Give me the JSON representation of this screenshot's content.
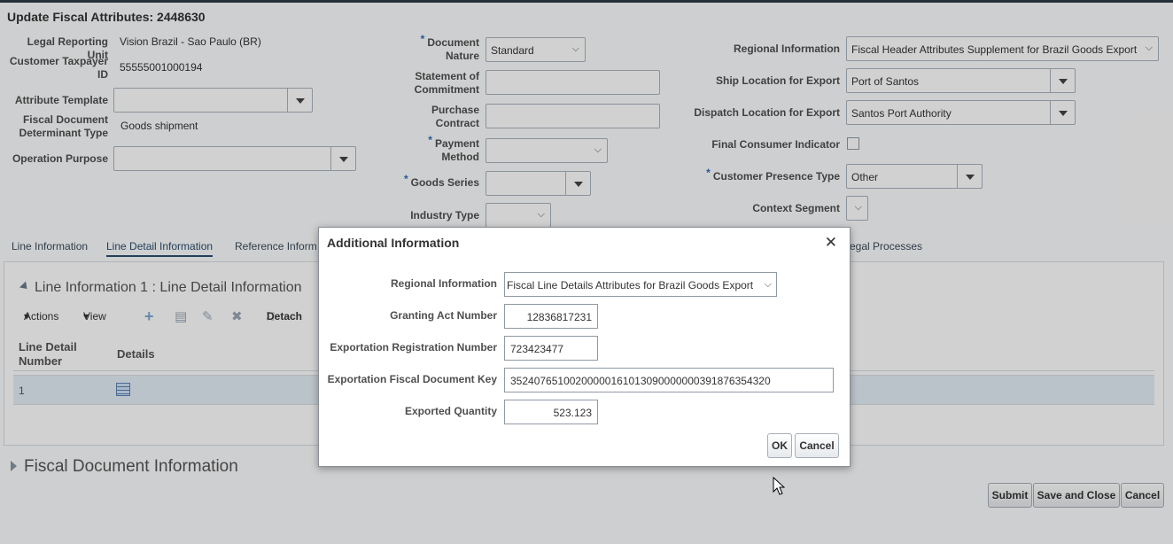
{
  "page": {
    "title": "Update Fiscal Attributes: 2448630"
  },
  "col1": {
    "legal_reporting_unit_label": "Legal Reporting Unit",
    "legal_reporting_unit_value": "Vision Brazil - Sao Paulo (BR)",
    "customer_taxpayer_label1": "Customer Taxpayer",
    "customer_taxpayer_label2": "ID",
    "customer_taxpayer_value": "55555001000194",
    "attribute_template_label": "Attribute Template",
    "attribute_template_value": "",
    "fiscal_doc_label1": "Fiscal Document",
    "fiscal_doc_label2": "Determinant Type",
    "fiscal_doc_value": "Goods shipment",
    "operation_purpose_label": "Operation Purpose",
    "operation_purpose_value": ""
  },
  "col2": {
    "document_nature_label1": "Document",
    "document_nature_label2": "Nature",
    "document_nature_value": "Standard",
    "statement_label1": "Statement of",
    "statement_label2": "Commitment",
    "purchase_label1": "Purchase",
    "purchase_label2": "Contract",
    "payment_label1": "Payment",
    "payment_label2": "Method",
    "goods_series_label": "Goods Series",
    "industry_type_label": "Industry Type",
    "required_mark": "*"
  },
  "col3": {
    "regional_info_label": "Regional Information",
    "regional_info_value": "Fiscal Header Attributes Supplement for Brazil Goods Export",
    "ship_location_label": "Ship Location for Export",
    "ship_location_value": "Port of Santos",
    "dispatch_location_label": "Dispatch Location for Export",
    "dispatch_location_value": "Santos Port Authority",
    "final_consumer_label": "Final Consumer Indicator",
    "customer_presence_label": "Customer Presence Type",
    "customer_presence_value": "Other",
    "context_segment_label": "Context Segment"
  },
  "tabs": [
    {
      "label": "Line Information"
    },
    {
      "label": "Line Detail Information"
    },
    {
      "label": "Reference Inform"
    },
    {
      "label": "egal Processes"
    }
  ],
  "panel": {
    "heading": "Line Information 1 : Line Detail Information",
    "actions_label": "Actions",
    "view_label": "View",
    "detach_label": "Detach",
    "col_line_detail_1": "Line Detail",
    "col_line_detail_2": "Number",
    "col_details": "Details",
    "rows": [
      {
        "number": "1"
      }
    ]
  },
  "fiscal_document_info": "Fiscal Document Information",
  "footer": {
    "submit": "Submit",
    "save_close": "Save and Close",
    "cancel": "Cancel"
  },
  "dialog": {
    "title": "Additional Information",
    "close_glyph": "✕",
    "regional_info_label": "Regional Information",
    "regional_info_value": "Fiscal Line Details Attributes for Brazil Goods Export",
    "granting_act_label": "Granting Act Number",
    "granting_act_value": "12836817231",
    "export_reg_label": "Exportation Registration Number",
    "export_reg_value": "723423477",
    "export_key_label": "Exportation Fiscal Document Key",
    "export_key_value": "35240765100200000161013090000000391876354320",
    "exported_qty_label": "Exported Quantity",
    "exported_qty_value": "523.123",
    "ok": "OK",
    "cancel": "Cancel"
  }
}
